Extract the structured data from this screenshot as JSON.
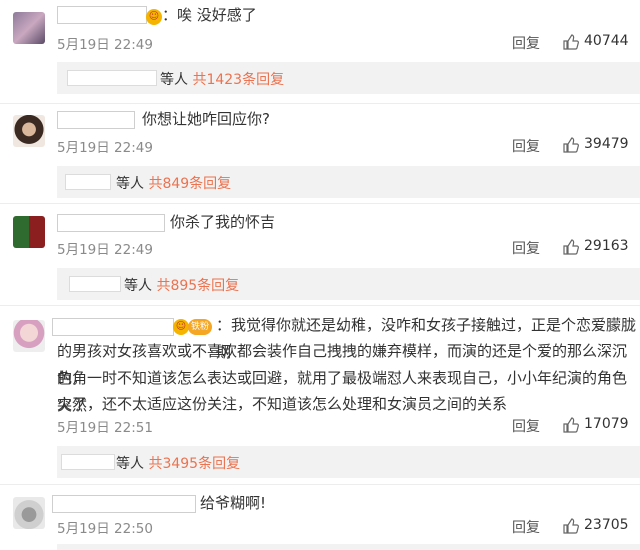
{
  "comments": [
    {
      "text": "：唉 没好感了",
      "date": "5月19日 22:49",
      "reply": "回复",
      "likes": "40744",
      "sub_prefix": "等人",
      "sub_link": "共1423条回复"
    },
    {
      "text": "你想让她咋回应你?",
      "date": "5月19日 22:49",
      "reply": "回复",
      "likes": "39479",
      "sub_prefix": "等人",
      "sub_link": "共849条回复"
    },
    {
      "text": "你杀了我的怀吉",
      "date": "5月19日 22:49",
      "reply": "回复",
      "likes": "29163",
      "sub_prefix": "等人",
      "sub_link": "共895条回复"
    },
    {
      "text_line1": "：我觉得你就还是幼稚，没咋和女孩子接触过，正是个恋爱朦胧期",
      "text_line2": "的男孩对女孩喜欢或不喜欢都会装作自己拽拽的嫌弃模样，而演的还是个爱的那么深沉的角",
      "text_line3": "色，一时不知道该怎么表达或回避，就用了最极端怼人来表现自己，小小年纪演的角色突然",
      "text_line4": "火了，还不太适应这份关注，不知道该怎么处理和女演员之间的关系",
      "badge_label": "铁粉",
      "date": "5月19日 22:51",
      "reply": "回复",
      "likes": "17079",
      "sub_prefix": "等人",
      "sub_link": "共3495条回复"
    },
    {
      "text": "给爷糊啊!",
      "date": "5月19日 22:50",
      "reply": "回复",
      "likes": "23705"
    }
  ],
  "icons": {
    "like": "thumbs-up-icon",
    "badge": "emoji-badge-icon"
  },
  "colors": {
    "link": "#eb7350",
    "date": "#8a8a8a"
  }
}
